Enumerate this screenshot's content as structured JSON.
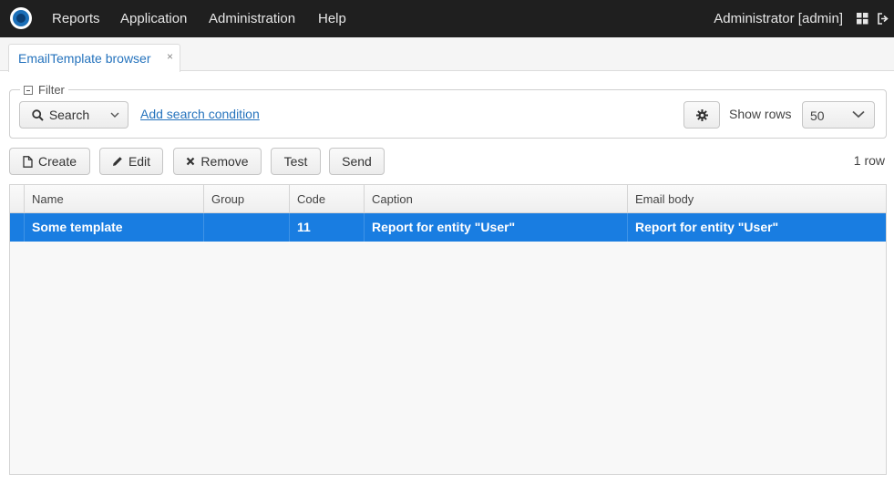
{
  "topbar": {
    "menu": [
      "Reports",
      "Application",
      "Administration",
      "Help"
    ],
    "user": "Administrator [admin]",
    "icons": [
      "app-logo-icon",
      "grid-icon",
      "logout-icon"
    ]
  },
  "tabs": [
    {
      "label": "EmailTemplate browser",
      "close": "×"
    }
  ],
  "filter": {
    "legend": "Filter",
    "search_label": "Search",
    "add_condition": "Add search condition",
    "show_rows_label": "Show rows",
    "show_rows_value": "50"
  },
  "toolbar": {
    "create": "Create",
    "edit": "Edit",
    "remove": "Remove",
    "test": "Test",
    "send": "Send",
    "row_count": "1 row"
  },
  "table": {
    "columns": [
      "Name",
      "Group",
      "Code",
      "Caption",
      "Email body"
    ],
    "rows": [
      [
        "Some template",
        "",
        "11",
        "Report for entity \"User\"",
        "Report for entity \"User\""
      ]
    ],
    "selected_row_color": "#197de1"
  },
  "colors": {
    "topbar": "#1f1f1f",
    "accent": "#2573bd",
    "selection": "#197de1"
  }
}
